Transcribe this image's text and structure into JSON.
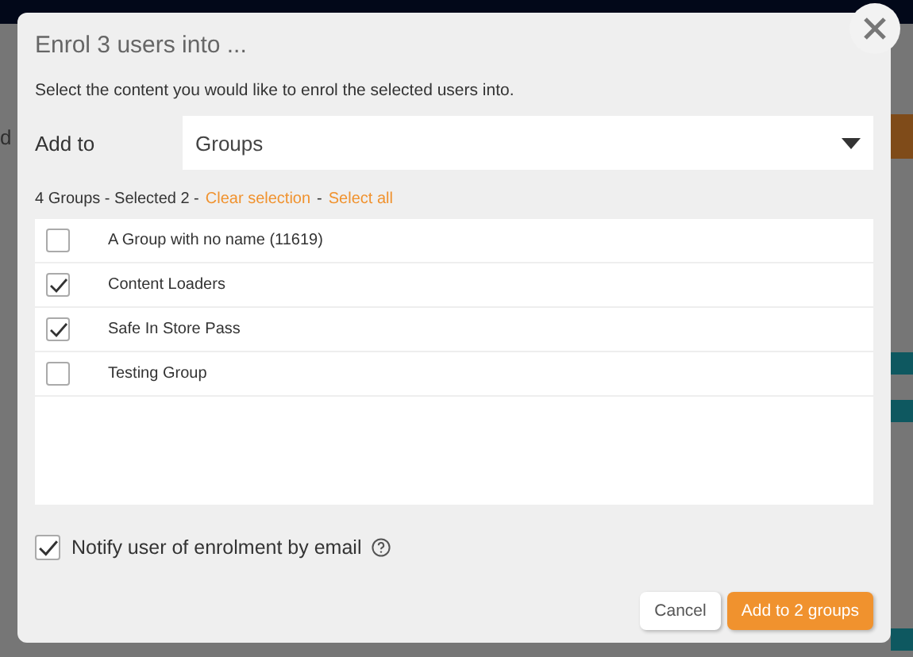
{
  "background": {
    "left_text": "d"
  },
  "dialog": {
    "title": "Enrol 3 users into ...",
    "subtitle": "Select the content you would like to enrol the selected users into.",
    "add_to": {
      "label": "Add to",
      "value": "Groups"
    },
    "status": {
      "count": "4 Groups - Selected 2 -",
      "clear": "Clear selection",
      "sep": "-",
      "select_all": "Select all"
    },
    "items": [
      {
        "label": "A Group with no name (11619)",
        "checked": false
      },
      {
        "label": "Content Loaders",
        "checked": true
      },
      {
        "label": "Safe In Store Pass",
        "checked": true
      },
      {
        "label": "Testing Group",
        "checked": false
      }
    ],
    "notify": {
      "label": "Notify user of enrolment by email",
      "checked": true
    },
    "buttons": {
      "cancel": "Cancel",
      "confirm": "Add to 2 groups"
    }
  }
}
